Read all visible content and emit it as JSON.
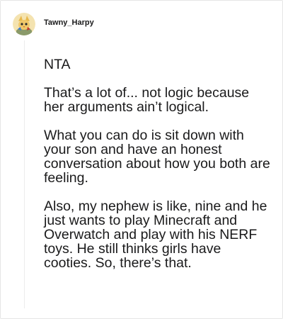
{
  "comment": {
    "author": "Tawny_Harpy",
    "avatar_icon": "bird-avatar-icon",
    "paragraphs": [
      "NTA",
      "That’s a lot of... not logic because her arguments ain’t logical.",
      "What you can do is sit down with your son and have an honest conversation about how you both are feeling.",
      "Also, my nephew is like, nine and he just wants to play Minecraft and Overwatch and play with his NERF toys. He still thinks girls have cooties. So, there’s that."
    ]
  },
  "colors": {
    "text": "#1a1a1b",
    "thread_line": "#ececec",
    "avatar_bg": "#f0d28a",
    "avatar_accent": "#3a7bd5"
  }
}
